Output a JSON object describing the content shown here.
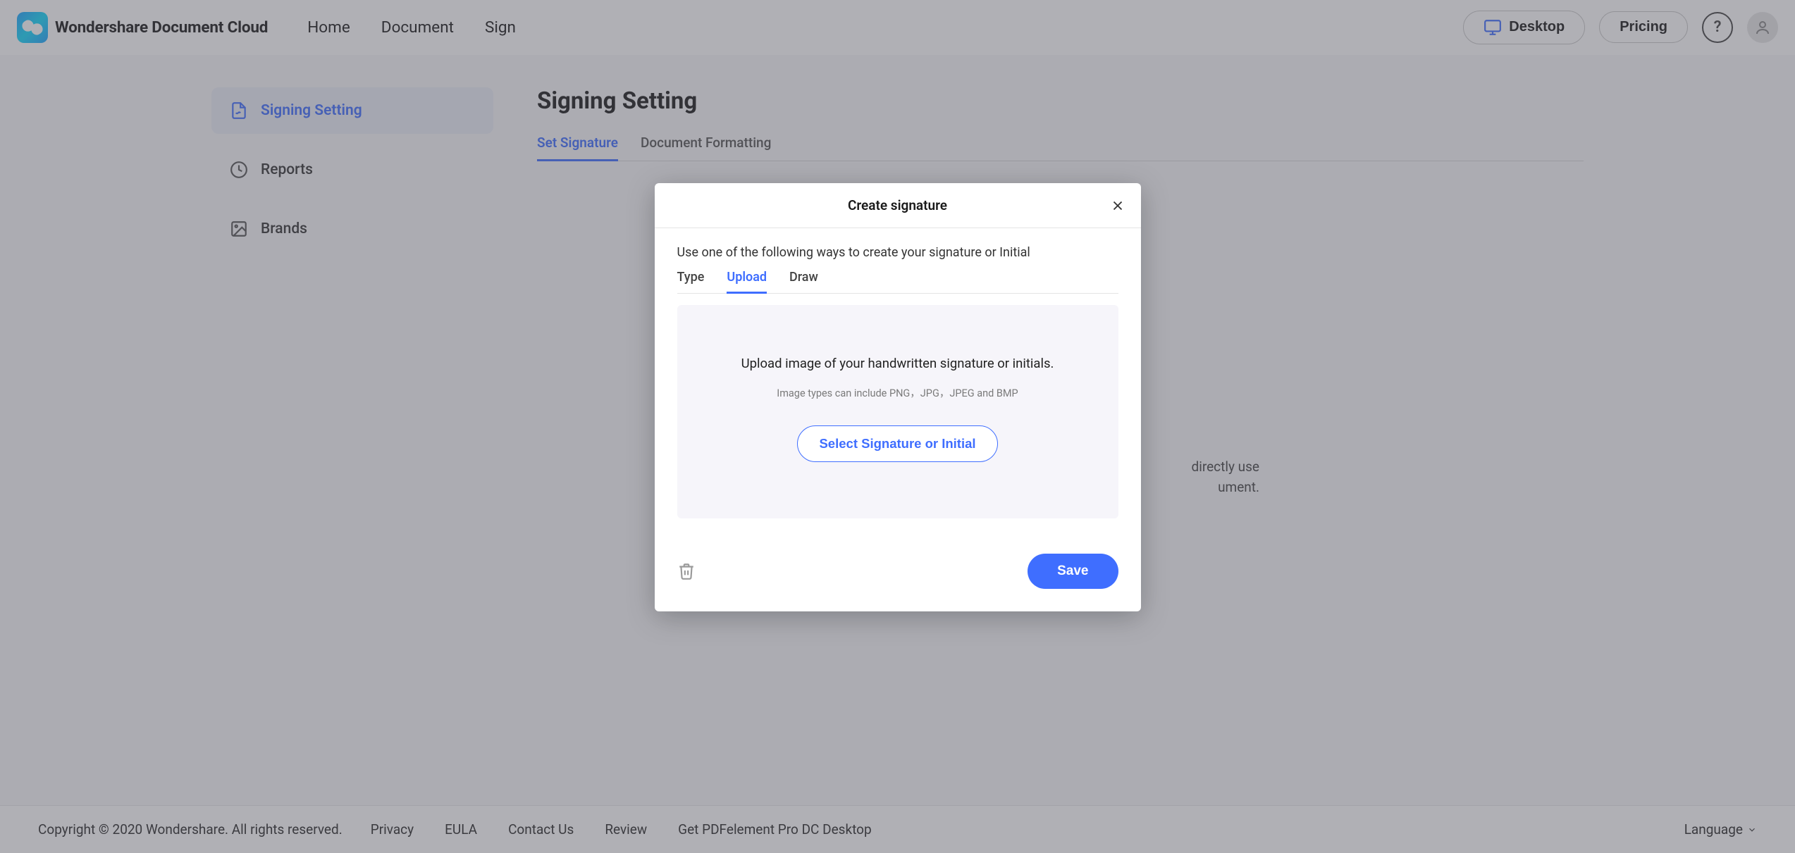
{
  "brand": {
    "text": "Wondershare Document Cloud"
  },
  "nav": {
    "home": "Home",
    "document": "Document",
    "sign": "Sign"
  },
  "header_buttons": {
    "desktop": "Desktop",
    "pricing": "Pricing"
  },
  "sidebar": {
    "items": [
      {
        "label": "Signing Setting",
        "icon": "file-sign",
        "active": true
      },
      {
        "label": "Reports",
        "icon": "clock",
        "active": false
      },
      {
        "label": "Brands",
        "icon": "image",
        "active": false
      }
    ]
  },
  "page": {
    "title": "Signing Setting",
    "tabs": [
      {
        "label": "Set Signature",
        "active": true
      },
      {
        "label": "Document Formatting",
        "active": false
      }
    ],
    "background_text_1": "directly use",
    "background_text_2": "ument."
  },
  "modal": {
    "title": "Create signature",
    "subtext": "Use one of the following ways to create your signature or Initial",
    "tabs": [
      {
        "label": "Type",
        "active": false
      },
      {
        "label": "Upload",
        "active": true
      },
      {
        "label": "Draw",
        "active": false
      }
    ],
    "dropzone": {
      "main": "Upload image of your handwritten signature or initials.",
      "sub": "Image types can include PNG，JPG，JPEG and BMP",
      "button": "Select Signature or Initial"
    },
    "save": "Save"
  },
  "footer": {
    "copyright": "Copyright © 2020 Wondershare. All rights reserved.",
    "links": {
      "privacy": "Privacy",
      "eula": "EULA",
      "contact": "Contact Us",
      "review": "Review",
      "download": "Get PDFelement Pro DC Desktop"
    },
    "language": "Language"
  },
  "colors": {
    "primary": "#3f6eff"
  }
}
